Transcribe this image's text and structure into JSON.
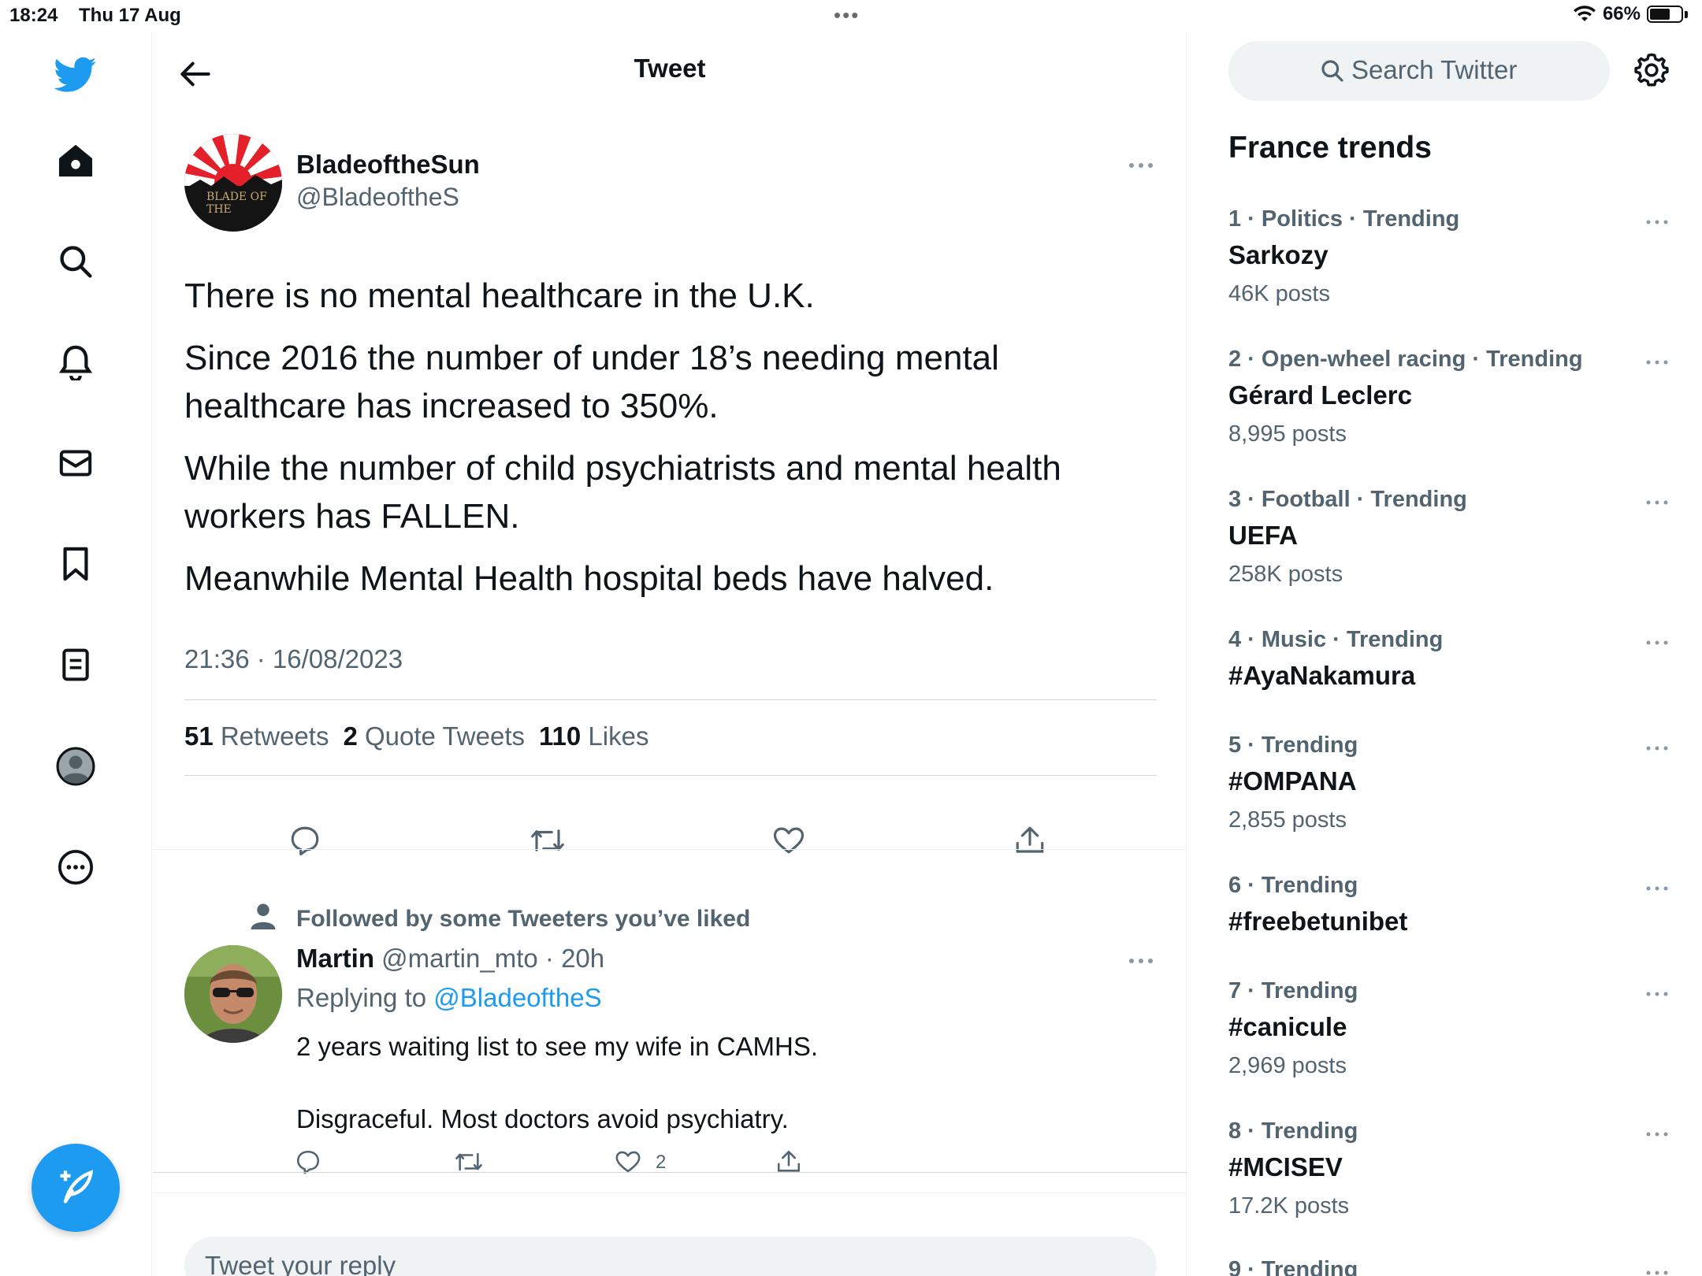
{
  "status_bar": {
    "time": "18:24",
    "date": "Thu 17 Aug",
    "battery": "66%",
    "battery_level": 0.66
  },
  "header": {
    "title": "Tweet"
  },
  "tweet": {
    "author_name": "BladeoftheSun",
    "author_handle": "@BladeoftheS",
    "avatar_text": "BLADE OF THE",
    "paragraphs": [
      "There is no mental healthcare in the U.K.",
      "Since 2016 the number of under 18’s needing mental healthcare has increased to 350%.",
      "While the number of child psychiatrists and mental health workers has FALLEN.",
      "Meanwhile Mental Health hospital beds have halved."
    ],
    "timestamp": "21:36 · 16/08/2023",
    "stats": {
      "retweets_count": "51",
      "retweets_label": "Retweets",
      "quotes_count": "2",
      "quotes_label": "Quote Tweets",
      "likes_count": "110",
      "likes_label": "Likes"
    }
  },
  "reply": {
    "context": "Followed by some Tweeters you’ve liked",
    "name": "Martin",
    "handle": "@martin_mto",
    "time": "· 20h",
    "replying_prefix": "Replying to",
    "replying_to": "@BladeoftheS",
    "lines": [
      "2 years waiting list to see my wife in CAMHS.",
      "Disgraceful. Most doctors avoid psychiatry."
    ],
    "like_count": "2"
  },
  "composer": {
    "placeholder": "Tweet your reply"
  },
  "sidebar": {
    "search_placeholder": "Search Twitter",
    "trends_title": "France trends",
    "trends": [
      {
        "meta": "1 · Politics · Trending",
        "name": "Sarkozy",
        "count": "46K posts"
      },
      {
        "meta": "2 · Open-wheel racing · Trending",
        "name": "Gérard Leclerc",
        "count": "8,995 posts"
      },
      {
        "meta": "3 · Football · Trending",
        "name": "UEFA",
        "count": "258K posts"
      },
      {
        "meta": "4 · Music · Trending",
        "name": "#AyaNakamura",
        "count": ""
      },
      {
        "meta": "5 · Trending",
        "name": "#OMPANA",
        "count": "2,855 posts"
      },
      {
        "meta": "6 · Trending",
        "name": "#freebetunibet",
        "count": ""
      },
      {
        "meta": "7 · Trending",
        "name": "#canicule",
        "count": "2,969 posts"
      },
      {
        "meta": "8 · Trending",
        "name": "#MCISEV",
        "count": "17.2K posts"
      },
      {
        "meta": "9 · Trending",
        "name": "",
        "count": ""
      }
    ]
  },
  "colors": {
    "accent": "#1d9bf0",
    "text": "#0f1419",
    "muted": "#536471"
  },
  "icons": [
    "twitter-logo-icon",
    "home-icon",
    "search-icon",
    "bell-icon",
    "mail-icon",
    "bookmark-icon",
    "lists-icon",
    "profile-icon",
    "more-circle-icon",
    "compose-icon",
    "back-arrow-icon",
    "reply-icon",
    "retweet-icon",
    "like-icon",
    "share-icon",
    "gear-icon",
    "person-icon",
    "wifi-icon"
  ]
}
